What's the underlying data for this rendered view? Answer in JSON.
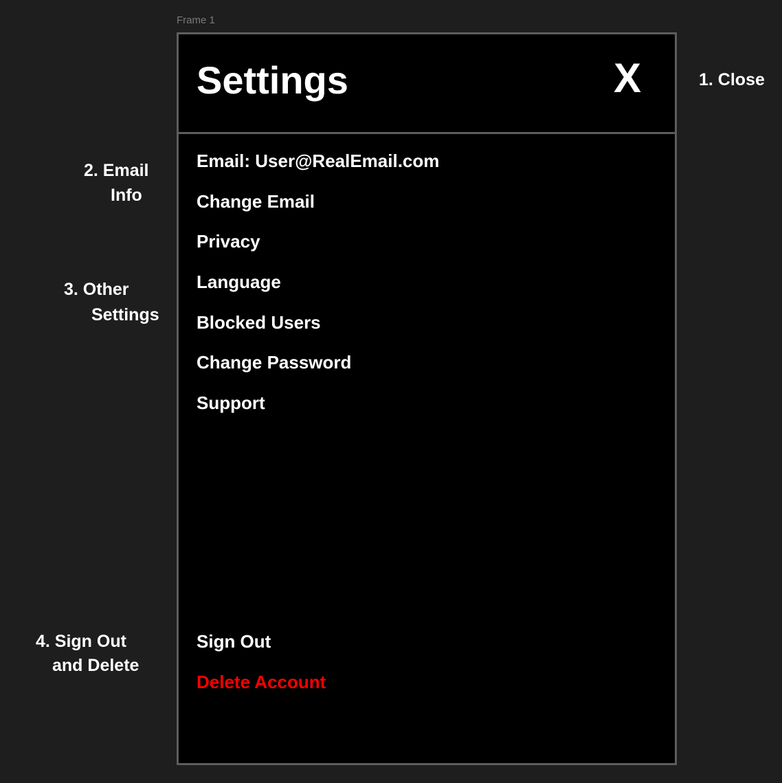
{
  "frame": {
    "label": "Frame 1"
  },
  "header": {
    "title": "Settings",
    "close_label": "X"
  },
  "menu": {
    "email_info": "Email: User@RealEmail.com",
    "items": [
      "Change Email",
      "Privacy",
      "Language",
      "Blocked Users",
      "Change Password",
      "Support"
    ],
    "sign_out": "Sign Out",
    "delete_account": "Delete Account"
  },
  "annotations": {
    "close": "1. Close",
    "email_line1": "2. Email",
    "email_line2": "Info",
    "other_line1": "3. Other",
    "other_line2": "Settings",
    "signout_line1": "4. Sign Out",
    "signout_line2": "and Delete"
  },
  "colors": {
    "canvas_bg": "#1e1e1e",
    "frame_bg": "#000000",
    "frame_border": "#5d5d5d",
    "text": "#ffffff",
    "danger": "#ff0000"
  }
}
